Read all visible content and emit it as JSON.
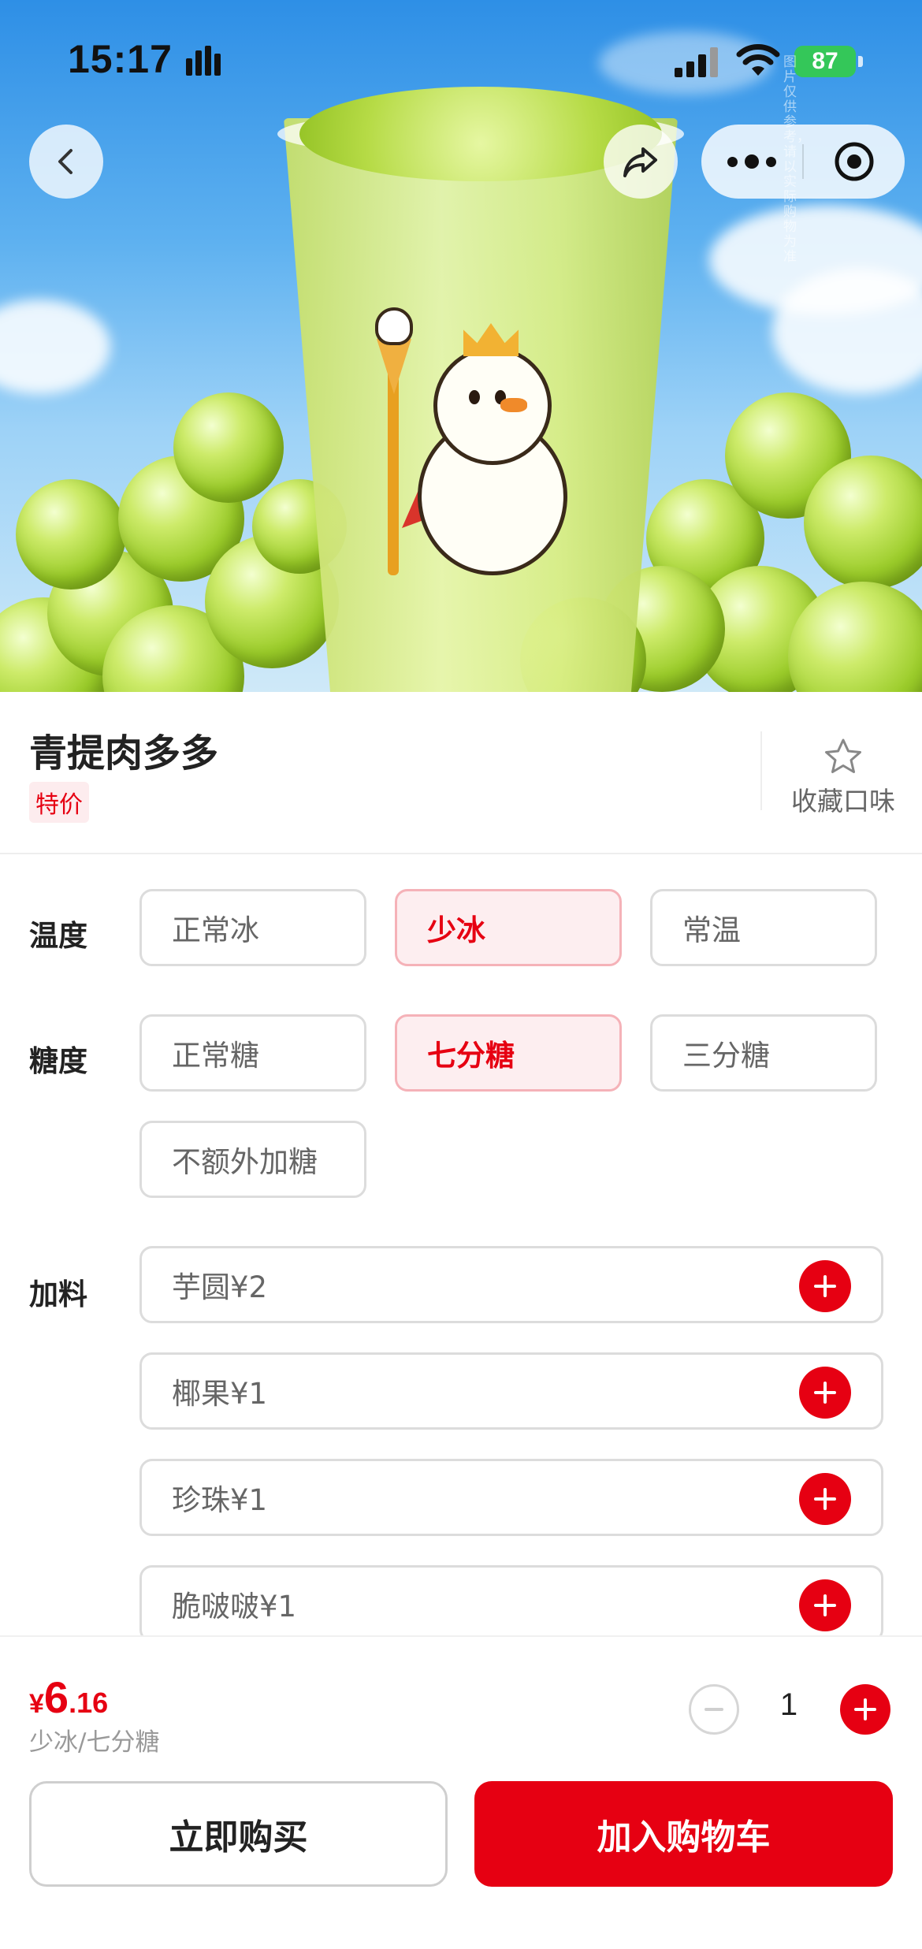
{
  "status_bar": {
    "time": "15:17",
    "battery": "87"
  },
  "nav": {
    "back_icon": "chevron-left-icon",
    "share_icon": "share-arrow-icon",
    "more_icon": "more-dots-icon",
    "close_icon": "target-close-icon",
    "watermark": "图片仅供参考，请以实际购物为准"
  },
  "product": {
    "name": "青提肉多多",
    "tag": "特价",
    "favorite_label": "收藏口味",
    "favorite_icon": "star-outline-icon"
  },
  "options": {
    "temperature": {
      "label": "温度",
      "choices": [
        "正常冰",
        "少冰",
        "常温"
      ],
      "selected": "少冰"
    },
    "sugar": {
      "label": "糖度",
      "choices": [
        "正常糖",
        "七分糖",
        "三分糖",
        "不额外加糖"
      ],
      "selected": "七分糖"
    },
    "toppings": {
      "label": "加料",
      "items": [
        "芋圆¥2",
        "椰果¥1",
        "珍珠¥1",
        "脆啵啵¥1"
      ]
    }
  },
  "cart": {
    "currency": "¥",
    "price_int": "6",
    "price_dec": ".16",
    "spec_summary": "少冰/七分糖",
    "quantity": "1",
    "buy_now_label": "立即购买",
    "add_cart_label": "加入购物车"
  },
  "colors": {
    "accent": "#e60012",
    "selected_bg": "#fdeef0",
    "battery": "#34c759"
  }
}
